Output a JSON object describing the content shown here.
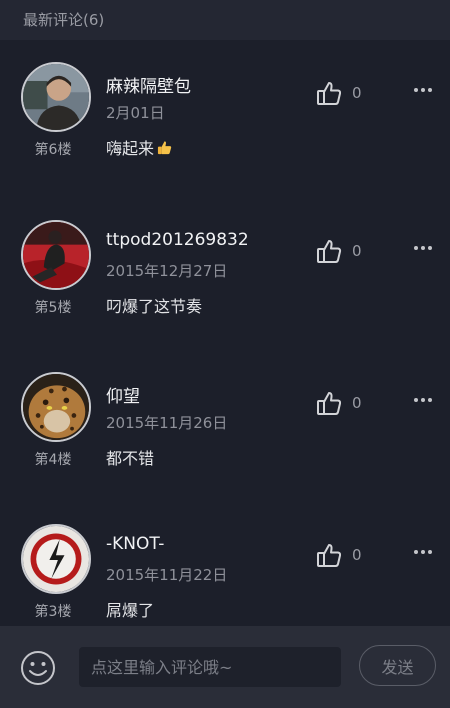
{
  "header": {
    "title": "最新评论(6)"
  },
  "comments": [
    {
      "username": "麻辣隔壁包",
      "date": "2月01日",
      "text": "嗨起来",
      "floor": "第6楼",
      "likes": "0",
      "emoji": "thumbs-up-emoji"
    },
    {
      "username": "ttpod201269832",
      "date": "2015年12月27日",
      "text": "叼爆了这节奏",
      "floor": "第5楼",
      "likes": "0"
    },
    {
      "username": "仰望",
      "date": "2015年11月26日",
      "text": "都不错",
      "floor": "第4楼",
      "likes": "0"
    },
    {
      "username": "-KNOT-",
      "date": "2015年11月22日",
      "text": "屌爆了",
      "floor": "第3楼",
      "likes": "0"
    }
  ],
  "input": {
    "placeholder": "点这里输入评论哦~"
  },
  "send_label": "发送",
  "colors": {
    "background": "#1c1f2a",
    "header": "#242733",
    "bottom_bar": "#2a2d38"
  }
}
